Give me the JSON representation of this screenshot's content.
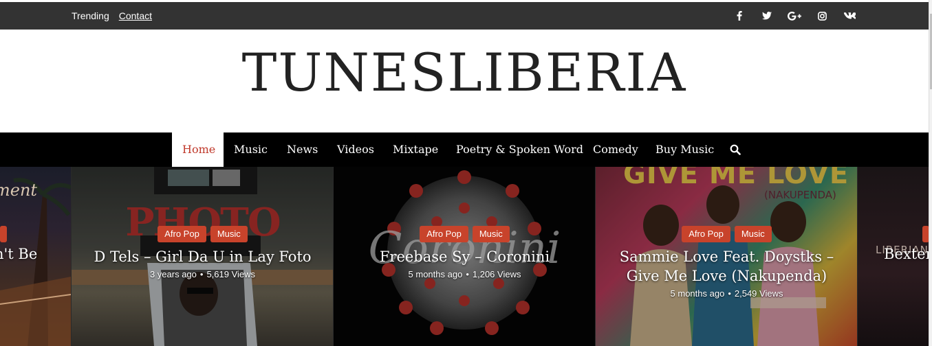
{
  "topbar": {
    "links": [
      {
        "label": "Trending"
      },
      {
        "label": "Contact"
      }
    ],
    "social": [
      "facebook-icon",
      "twitter-icon",
      "google-plus-icon",
      "instagram-icon",
      "vk-icon"
    ]
  },
  "header": {
    "logo": "TUNESLIBERIA"
  },
  "nav": {
    "items": [
      {
        "label": "Home",
        "active": true
      },
      {
        "label": "Music"
      },
      {
        "label": "News"
      },
      {
        "label": "Videos"
      },
      {
        "label": "Mixtape"
      },
      {
        "label": "Poetry & Spoken Word"
      },
      {
        "label": "Comedy"
      },
      {
        "label": "Buy Music"
      }
    ],
    "search_icon": "search-icon"
  },
  "slider": {
    "left_partial": {
      "title": "n't Be",
      "art_text": "ment"
    },
    "cards": [
      {
        "tags": [
          "Afro Pop",
          "Music"
        ],
        "title": "D Tels – Girl Da U in Lay Foto",
        "time": "3 years ago",
        "views": "5,619 Views",
        "art_text": "PHOTO"
      },
      {
        "tags": [
          "Afro Pop",
          "Music"
        ],
        "title": "Freebase Sy – Coronini",
        "time": "5 months ago",
        "views": "1,206 Views",
        "art_text": "Coronini"
      },
      {
        "tags": [
          "Afro Pop",
          "Music"
        ],
        "title": "Sammie Love Feat. Doystks – Give Me Love (Nakupenda)",
        "time": "5 months ago",
        "views": "2,549 Views",
        "art_text": "GIVE ME LOVE",
        "art_subtext": "(NAKUPENDA)"
      }
    ],
    "right_partial": {
      "title": "Bexter",
      "art_text": "LIBERIAN"
    }
  },
  "colors": {
    "accent": "#c8432b",
    "topbar": "#333333",
    "nav": "#000000",
    "active": "#c0392b"
  }
}
